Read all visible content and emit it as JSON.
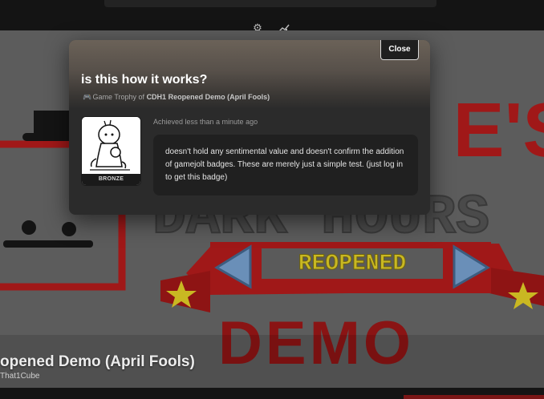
{
  "topbar": {
    "icons": [
      "gear-icon",
      "stats-icon"
    ]
  },
  "hero": {
    "title": "opened Demo (April Fools)",
    "subtitle": "That1Cube",
    "art_text_top": "E'S",
    "art_text_mid": "DARK HOURS",
    "art_banner": "REOPENED",
    "art_bottom": "DEMO"
  },
  "modal": {
    "close_label": "Close",
    "trophy_title": "is this how it works?",
    "meta_prefix": "Game Trophy of",
    "game_name": "CDH1 Reopened Demo (April Fools)",
    "achieved": "Achieved less than a minute ago",
    "description": "doesn't hold any sentimental value and doesn't confirm the addition of gamejolt badges. These are merely just a simple test. (just log in to get this badge)",
    "badge_tier": "BRONZE"
  },
  "colors": {
    "modal_bg": "#2b2b2b",
    "desc_bg": "#202020",
    "art_red": "#a01818",
    "art_yellow": "#c9b822"
  }
}
